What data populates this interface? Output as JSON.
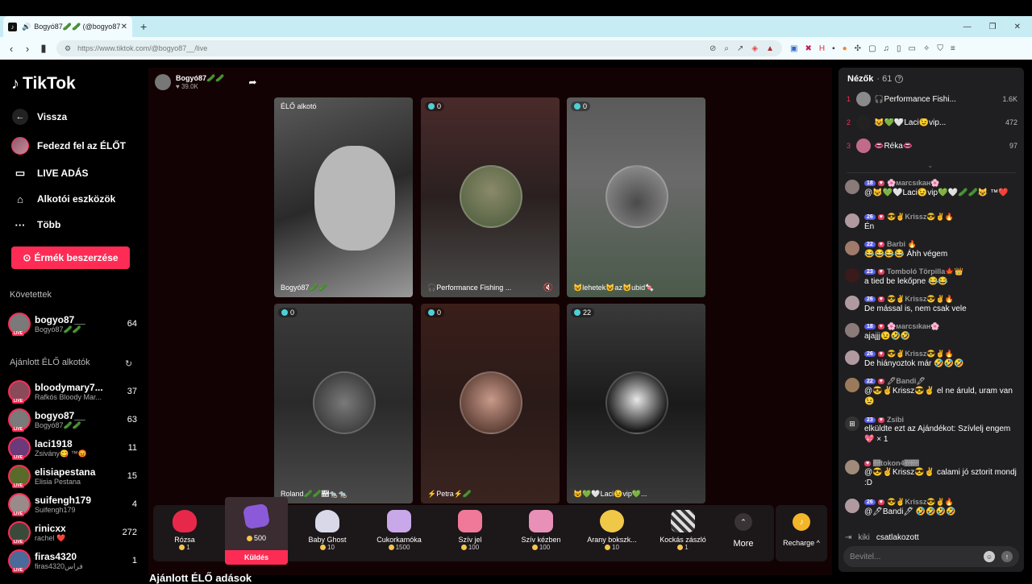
{
  "browser": {
    "tab_title": "Bogyó87🥒🥒 (@bogyo87",
    "url": "https://www.tiktok.com/@bogyo87__/live"
  },
  "sidebar": {
    "logo": "TikTok",
    "menu": [
      {
        "label": "Vissza",
        "icon": "arrow-left-icon"
      },
      {
        "label": "Fedezd fel az ÉLŐT",
        "icon": "avatar-icon"
      },
      {
        "label": "LIVE ADÁS",
        "icon": "video-icon"
      },
      {
        "label": "Alkotói eszközök",
        "icon": "home-icon"
      },
      {
        "label": "Több",
        "icon": "more-icon"
      }
    ],
    "coins_button": "Érmék beszerzése",
    "following_title": "Követettek",
    "following": [
      {
        "name": "bogyo87__",
        "sub": "Bogyó87🥒🥒",
        "count": "64"
      }
    ],
    "recommended_title": "Ajánlott ÉLŐ alkotók",
    "recommended": [
      {
        "name": "bloodymary7...",
        "sub": "Rafkós Bloody Mar...",
        "count": "37"
      },
      {
        "name": "bogyo87__",
        "sub": "Bogyó87🥒🥒",
        "count": "63"
      },
      {
        "name": "laci1918",
        "sub": "Zsivány😋 ™😡",
        "count": "11"
      },
      {
        "name": "elisiapestana",
        "sub": "Elisia Pestana",
        "count": "15"
      },
      {
        "name": "suifengh179",
        "sub": "Suifengh179",
        "count": "4"
      },
      {
        "name": "rinicxx",
        "sub": "rachel ❤️",
        "count": "272"
      },
      {
        "name": "firas4320",
        "sub": "firas4320فراس",
        "count": "1"
      }
    ]
  },
  "stage": {
    "host_name": "Bogyó87🥒🥒",
    "host_likes": "♥ 39.0K",
    "tiles": [
      {
        "top_label": "ÉLŐ alkotó",
        "label": "Bogyó87🥒🥒",
        "viewers": ""
      },
      {
        "top_label": "",
        "label": "🎧Performance Fishing ...",
        "viewers": "0"
      },
      {
        "top_label": "",
        "label": "😺lehetek😺az😺ubid🍬",
        "viewers": "0"
      },
      {
        "top_label": "",
        "label": "Roland🥒🥒🛛🐀🐀",
        "viewers": "0"
      },
      {
        "top_label": "",
        "label": "⚡Petra⚡🥒",
        "viewers": "0"
      },
      {
        "top_label": "",
        "label": "😺💚🤍Laci😉vip💚...",
        "viewers": "22"
      }
    ],
    "gifts": [
      {
        "name": "Rózsa",
        "price": "1",
        "color": "#e8284a"
      },
      {
        "name": "",
        "price": "500",
        "color": "#8a5ad8"
      },
      {
        "name": "Baby Ghost",
        "price": "10",
        "color": "#d8d8e8"
      },
      {
        "name": "Cukorkamóka",
        "price": "1500",
        "color": "#c8a8e8"
      },
      {
        "name": "Szív jel",
        "price": "100",
        "color": "#f07898"
      },
      {
        "name": "Szív kézben",
        "price": "100",
        "color": "#e890b8"
      },
      {
        "name": "Arany bokszk...",
        "price": "10",
        "color": "#f0c848"
      },
      {
        "name": "Kockás zászló",
        "price": "1",
        "color": "#dddddd"
      }
    ],
    "send_label": "Küldés",
    "more_label": "More",
    "recharge_label": "Recharge ^",
    "suggest_title": "Ajánlott ÉLŐ adások"
  },
  "chat": {
    "viewers_title": "Nézők",
    "viewers_count": "· 61",
    "top_viewers": [
      {
        "rank": "1",
        "name": "🎧Performance Fishi...",
        "value": "1.6K"
      },
      {
        "rank": "2",
        "name": "😺💚🤍Laci😉vip...",
        "value": "472"
      },
      {
        "rank": "3",
        "name": "👄Réka👄",
        "value": "97"
      }
    ],
    "messages": [
      {
        "lvl": "18",
        "name": "🌸мarcsıkaн🌸",
        "text": "@😺💚🤍Laci😉vip💚🤍🥒🥒😺 ™❤️",
        "avatar": "#8a7a7a"
      },
      {
        "lvl": "26",
        "name": "😎✌Krissz😎✌🔥",
        "text": "Én",
        "avatar": "#b09aa0"
      },
      {
        "lvl": "22",
        "name": "Barbi 🔥",
        "text": "😂😂😂😂 Áhh végem",
        "avatar": "#a07a6a"
      },
      {
        "lvl": "23",
        "name": "Tomboló Törpilla🍁👑",
        "text": "a tied be lekőpne 😂😂",
        "avatar": "#3a1a1a"
      },
      {
        "lvl": "26",
        "name": "😎✌Krissz😎✌🔥",
        "text": "De mással is, nem csak vele",
        "avatar": "#b09aa0"
      },
      {
        "lvl": "18",
        "name": "🌸мarcsıkaн🌸",
        "text": "ajajjj😉🤣🤣",
        "avatar": "#8a7a7a"
      },
      {
        "lvl": "26",
        "name": "😎✌Krissz😎✌🔥",
        "text": "De hiányoztok már 🤣🤣🤣",
        "avatar": "#b09aa0"
      },
      {
        "lvl": "22",
        "name": "🖊Bandi🖊",
        "text": "@😎✌Krissz😎✌ el ne áruld, uram van😉",
        "avatar": "#9a7a5a"
      },
      {
        "lvl": "23",
        "name": "Zsibi",
        "text": "elküldte ezt az Ajándékot: Szívlelj engem 💖 × 1",
        "avatar": "#333333"
      },
      {
        "lvl": "",
        "name": "🛛tokon4🛛🛛",
        "text": "@😎✌Krissz😎✌ calami jó sztorit mondj :D",
        "avatar": "#a08a7a"
      },
      {
        "lvl": "26",
        "name": "😎✌Krissz😎✌🔥",
        "text": "@🖊Bandi🖊 🤣🤣🤣🤣",
        "avatar": "#b09aa0"
      }
    ],
    "join_name": "kiki",
    "join_text": "csatlakozott",
    "input_placeholder": "Bevitel..."
  }
}
